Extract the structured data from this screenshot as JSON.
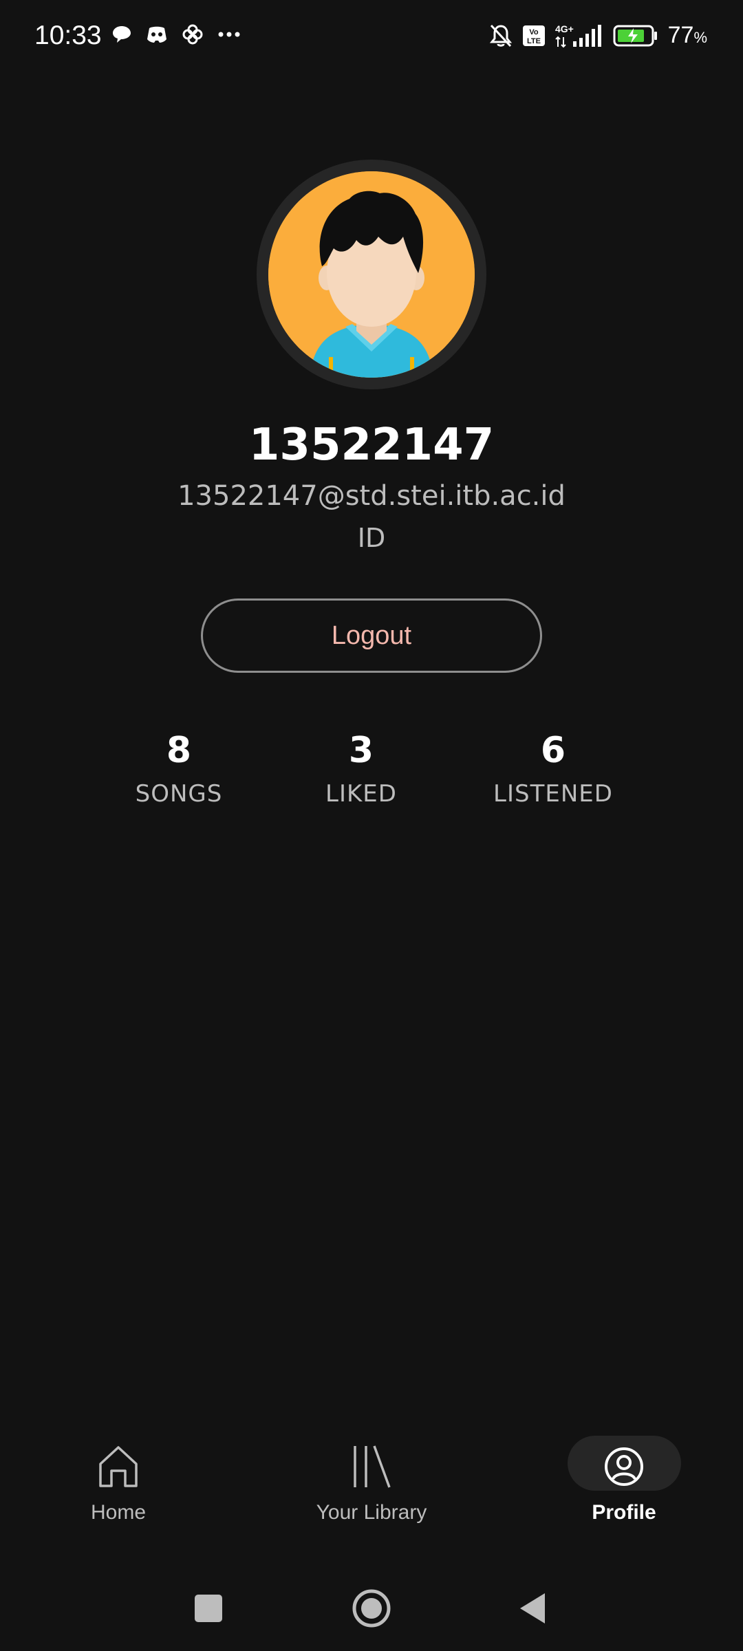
{
  "status_bar": {
    "time": "10:33",
    "battery_percent": "77",
    "battery_unit": "%",
    "network": "4G+",
    "volte": "Vo LTE"
  },
  "profile": {
    "username": "13522147",
    "email": "13522147@std.stei.itb.ac.id",
    "country": "ID",
    "logout_label": "Logout"
  },
  "stats": [
    {
      "value": "8",
      "label": "SONGS"
    },
    {
      "value": "3",
      "label": "LIKED"
    },
    {
      "value": "6",
      "label": "LISTENED"
    }
  ],
  "bottom_nav": {
    "items": [
      {
        "label": "Home",
        "icon": "home-icon",
        "active": false
      },
      {
        "label": "Your Library",
        "icon": "library-icon",
        "active": false
      },
      {
        "label": "Profile",
        "icon": "profile-icon",
        "active": true
      }
    ]
  },
  "colors": {
    "background": "#121212",
    "logout_text": "#f4b8ad",
    "avatar_bg": "#fbad3c",
    "battery_green": "#4cd137"
  }
}
